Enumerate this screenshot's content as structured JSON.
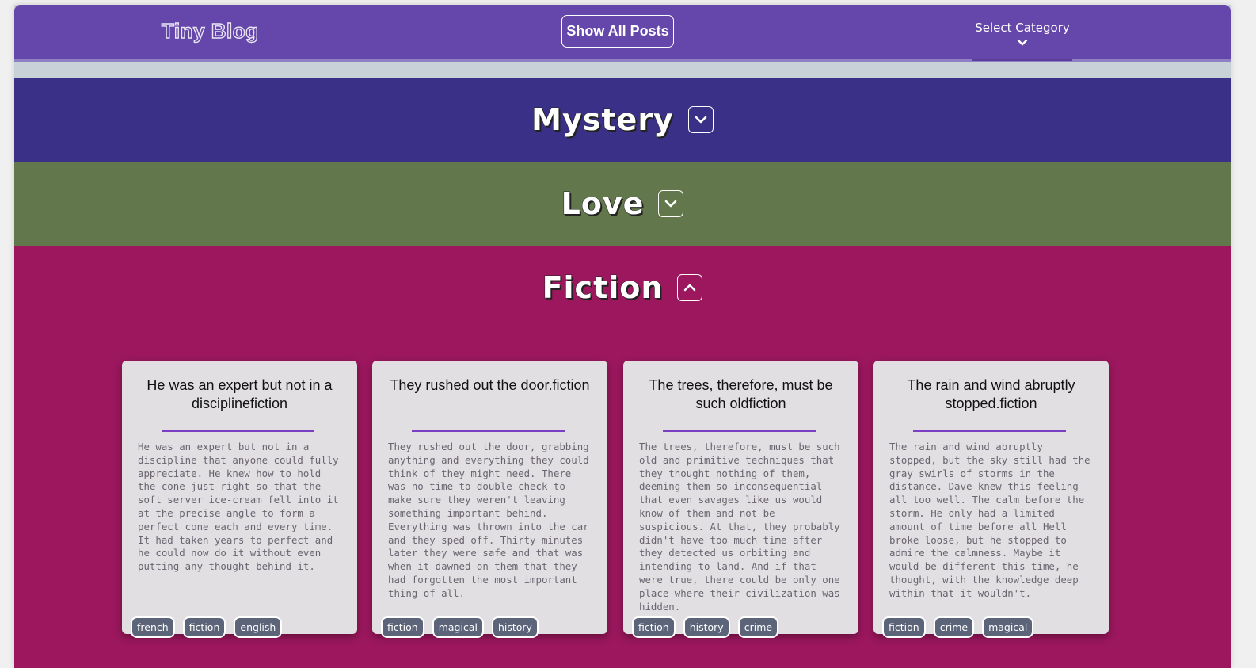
{
  "header": {
    "logo": "Tiny Blog",
    "show_all_label": "Show All Posts",
    "select_category_label": "Select Category"
  },
  "colors": {
    "header": "#6546aa",
    "mystery": "#3a3087",
    "love": "#62774b",
    "fiction": "#9c175e",
    "card_bg": "#e1dfe2",
    "tag_bg": "#5b6478",
    "rule": "#7b3fc4"
  },
  "categories": [
    {
      "name": "Mystery",
      "expanded": false,
      "icon": "chevron-down-icon"
    },
    {
      "name": "Love",
      "expanded": false,
      "icon": "chevron-down-icon"
    },
    {
      "name": "Fiction",
      "expanded": true,
      "icon": "chevron-up-icon"
    }
  ],
  "posts": [
    {
      "title": "He was an expert but not in a disciplinefiction",
      "body": "He was an expert but not in a discipline that anyone could fully appreciate. He knew how to hold the cone just right so that the soft server ice-cream fell into it at the precise angle to form a perfect cone each and every time. It had taken years to perfect and he could now do it without even putting any thought behind it.",
      "tags": [
        "french",
        "fiction",
        "english"
      ]
    },
    {
      "title": "They rushed out the door.fiction",
      "body": "They rushed out the door, grabbing anything and everything they could think of they might need. There was no time to double-check to make sure they weren't leaving something important behind. Everything was thrown into the car and they sped off. Thirty minutes later they were safe and that was when it dawned on them that they had forgotten the most important thing of all.",
      "tags": [
        "fiction",
        "magical",
        "history"
      ]
    },
    {
      "title": "The trees, therefore, must be such oldfiction",
      "body": "The trees, therefore, must be such old and primitive techniques that they thought nothing of them, deeming them so inconsequential that even savages like us would know of them and not be suspicious. At that, they probably didn't have too much time after they detected us orbiting and intending to land. And if that were true, there could be only one place where their civilization was hidden.",
      "tags": [
        "fiction",
        "history",
        "crime"
      ]
    },
    {
      "title": "The rain and wind abruptly stopped.fiction",
      "body": "The rain and wind abruptly stopped, but the sky still had the gray swirls of storms in the distance. Dave knew this feeling all too well. The calm before the storm. He only had a limited amount of time before all Hell broke loose, but he stopped to admire the calmness. Maybe it would be different this time, he thought, with the knowledge deep within that it wouldn't.",
      "tags": [
        "fiction",
        "crime",
        "magical"
      ]
    }
  ]
}
